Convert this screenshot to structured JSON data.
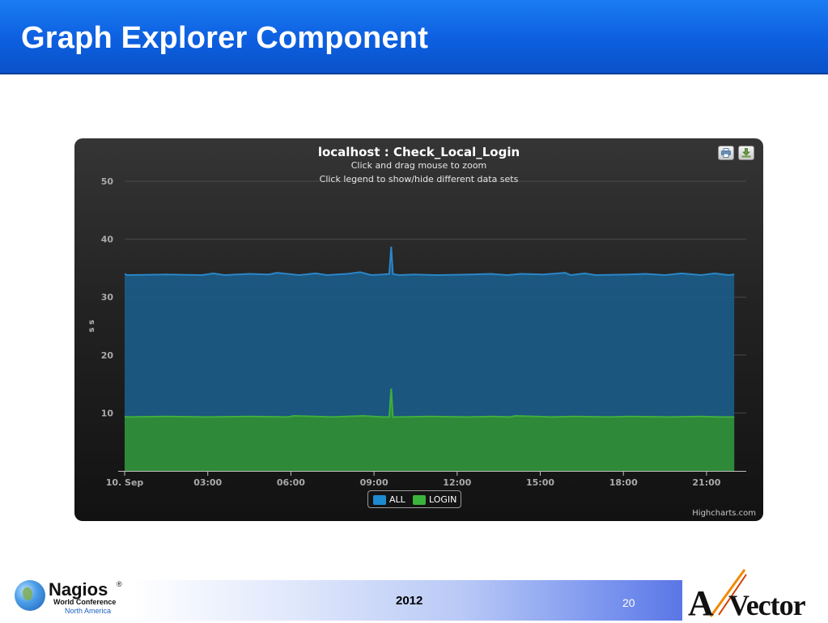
{
  "slide": {
    "title": "Graph Explorer Component",
    "footer_year": "2012",
    "page_number": "20"
  },
  "logos": {
    "left": {
      "name": "Nagios",
      "registered": "®",
      "line2": "World Conference",
      "line3": "North America"
    },
    "right": {
      "text": "Vector",
      "prefix": "A"
    }
  },
  "chart": {
    "title": "localhost : Check_Local_Login",
    "subtitle1": "Click and drag mouse to zoom",
    "subtitle2": "Click legend to show/hide different data sets",
    "credits": "Highcharts.com",
    "colors": {
      "ALL": "#1b5a85",
      "LOGIN": "#2f8a36",
      "ALL_legend": "#1e8ad0",
      "LOGIN_legend": "#3bb43a"
    }
  },
  "chart_data": {
    "type": "area",
    "title": "localhost : Check_Local_Login",
    "xlabel": "",
    "ylabel": "s s",
    "ylim": [
      0,
      50
    ],
    "yticks": [
      10,
      20,
      30,
      40,
      50
    ],
    "xlim_hours": [
      0,
      22.2
    ],
    "xticks": [
      {
        "hour": 0,
        "label": "10. Sep"
      },
      {
        "hour": 3,
        "label": "03:00"
      },
      {
        "hour": 6,
        "label": "06:00"
      },
      {
        "hour": 9,
        "label": "09:00"
      },
      {
        "hour": 12,
        "label": "12:00"
      },
      {
        "hour": 15,
        "label": "15:00"
      },
      {
        "hour": 18,
        "label": "18:00"
      },
      {
        "hour": 21,
        "label": "21:00"
      }
    ],
    "grid": true,
    "legend": "bottom-center",
    "series": [
      {
        "name": "ALL",
        "x": [
          0,
          0.1,
          1.5,
          2.8,
          3.2,
          3.6,
          4.5,
          5.2,
          5.5,
          6.3,
          6.9,
          7.3,
          8.0,
          8.5,
          8.9,
          9.3,
          9.55,
          9.62,
          9.68,
          9.9,
          10.4,
          11.3,
          12.5,
          13.2,
          13.8,
          14.3,
          15.1,
          15.9,
          16.1,
          16.6,
          17.0,
          18.2,
          18.8,
          19.5,
          20.1,
          20.8,
          21.3,
          21.8,
          22.0
        ],
        "y": [
          34.0,
          33.8,
          33.9,
          33.8,
          34.1,
          33.8,
          34.0,
          33.9,
          34.2,
          33.8,
          34.1,
          33.8,
          34.0,
          34.3,
          33.8,
          33.9,
          34.0,
          38.7,
          34.0,
          33.8,
          33.9,
          33.8,
          33.9,
          34.0,
          33.8,
          34.0,
          33.9,
          34.2,
          33.8,
          34.1,
          33.8,
          33.9,
          34.0,
          33.8,
          34.1,
          33.8,
          34.1,
          33.8,
          33.9
        ]
      },
      {
        "name": "LOGIN",
        "x": [
          0,
          0.1,
          1.5,
          3.0,
          4.5,
          5.9,
          6.1,
          7.5,
          8.6,
          9.3,
          9.55,
          9.62,
          9.68,
          9.9,
          11.0,
          12.4,
          13.3,
          13.9,
          14.1,
          15.4,
          16.2,
          17.5,
          18.2,
          19.7,
          20.8,
          21.5,
          22.0
        ],
        "y": [
          9.4,
          9.3,
          9.4,
          9.3,
          9.4,
          9.3,
          9.5,
          9.3,
          9.5,
          9.3,
          9.3,
          14.2,
          9.3,
          9.3,
          9.4,
          9.3,
          9.4,
          9.3,
          9.5,
          9.3,
          9.4,
          9.3,
          9.4,
          9.3,
          9.4,
          9.3,
          9.3
        ]
      }
    ]
  }
}
